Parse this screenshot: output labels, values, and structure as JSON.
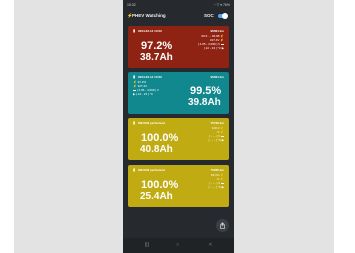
{
  "status_bar": {
    "time": "15:32",
    "right": "◔ ▽ ▾ 76%"
  },
  "app": {
    "title": "PHEV Watching",
    "soc_label": "SOC",
    "soc_toggle_on": true
  },
  "cards": [
    {
      "color": "#8e2313",
      "date": "2024-02-14 10:02",
      "km": "96564 km",
      "lines": [
        "99.5 → 96.88 ⚡",
        "327.4V ⚡",
        "[ 4.05 - 4.099 ] V ▬",
        "[ 22 - 23 ] °C ▶"
      ],
      "percent": "97.2%",
      "ah": "38.7Ah"
    },
    {
      "color": "#10888d",
      "date": "2024-02-14 10:02",
      "km": "96564 km",
      "lines": [
        "⚡ 97.2%",
        "⚡ 327.4V",
        "▬ [ 4.05 - 4.099 ] V",
        "▶ [ 22 - 23 ] °C"
      ],
      "percent": "99.5%",
      "ah": "39.8Ah"
    },
    {
      "color": "#c0ab12",
      "date": "DBCKM performed",
      "km": "75738 km",
      "lines": [
        "100.0 ⚡",
        "-V ⚡",
        "[ - - - ] V ▬",
        "[ - - - ] °C ▶"
      ],
      "percent": "100.0%",
      "ah": "40.8Ah"
    },
    {
      "color": "#c0ab12",
      "date": "DBCKM performed",
      "km": "75266 km",
      "lines": [
        "63.1% ⚡",
        "-V ⚡",
        "[ - - - ] V ▬",
        "[ - - - ] °C ▶"
      ],
      "percent": "100.0%",
      "ah": "25.4Ah"
    }
  ],
  "nav": {
    "recents": "|||",
    "home": "○",
    "back": "<"
  }
}
